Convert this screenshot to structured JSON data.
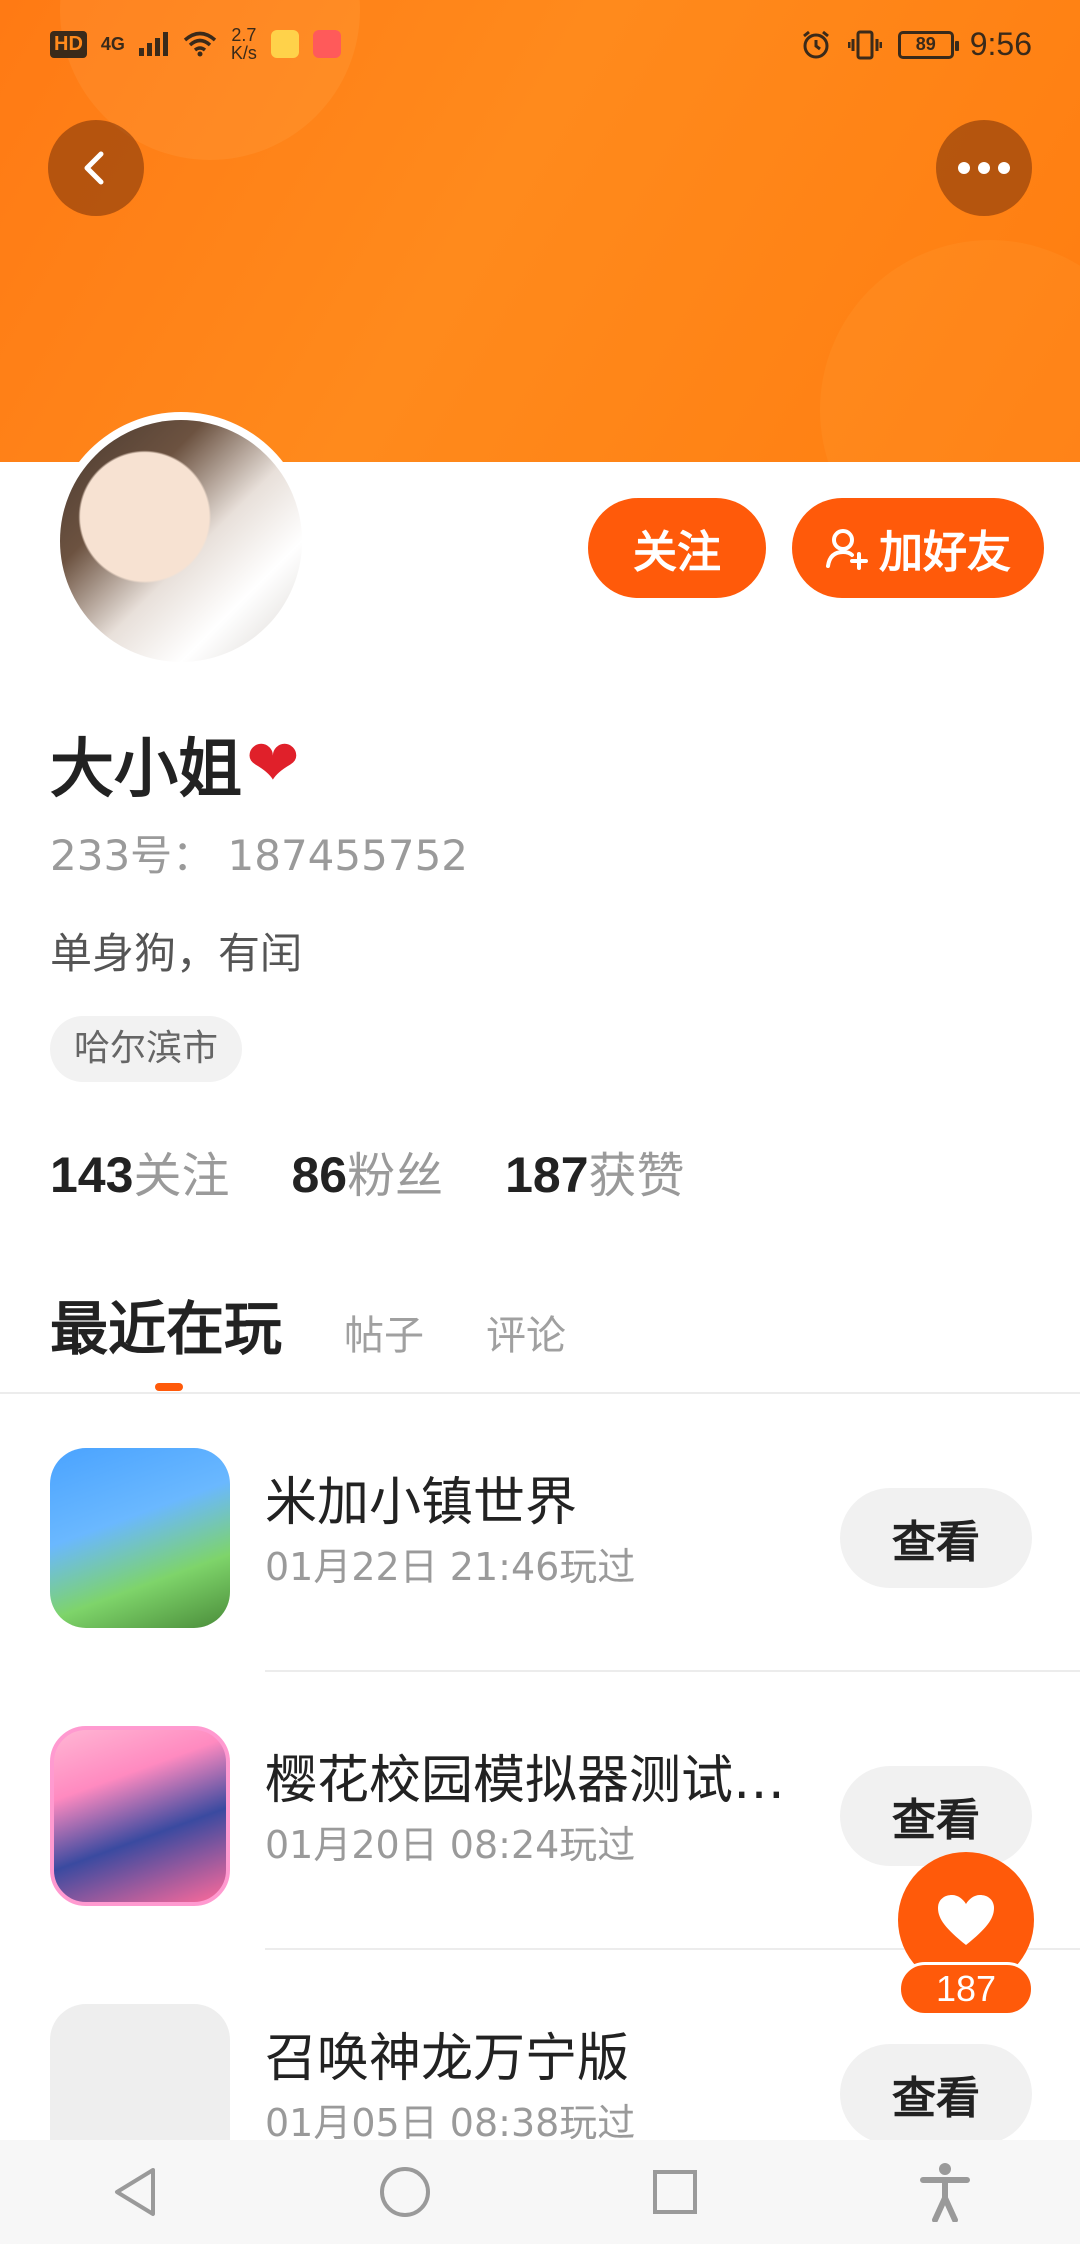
{
  "status_bar": {
    "hd": "HD",
    "network": "4G",
    "speed_value": "2.7",
    "speed_unit": "K/s",
    "battery": "89",
    "time": "9:56"
  },
  "header": {
    "background_color": "#ff8a1c",
    "back_icon": "chevron-left-icon",
    "more_icon": "more-dots-icon"
  },
  "actions": {
    "follow_label": "关注",
    "add_friend_label": "加好友",
    "accent_color": "#ff5a0a"
  },
  "profile": {
    "name": "大小姐",
    "name_emoji": "❤",
    "id_line": "233号：  187455752",
    "bio": "单身狗，有闰",
    "location": "哈尔滨市"
  },
  "stats": [
    {
      "value": "143",
      "label": "关注"
    },
    {
      "value": "86",
      "label": "粉丝"
    },
    {
      "value": "187",
      "label": "获赞"
    }
  ],
  "tabs": [
    {
      "label": "最近在玩",
      "active": true
    },
    {
      "label": "帖子",
      "active": false
    },
    {
      "label": "评论",
      "active": false
    }
  ],
  "games": [
    {
      "title": "米加小镇世界",
      "played": "01月22日 21:46玩过",
      "button": "查看"
    },
    {
      "title": "樱花校园模拟器测试…",
      "played": "01月20日 08:24玩过",
      "button": "查看"
    },
    {
      "title": "召唤神龙万宁版",
      "played": "01月05日 08:38玩过",
      "button": "查看"
    }
  ],
  "like_fab": {
    "icon": "heart-icon",
    "count": "187"
  },
  "nav": [
    "back-triangle-icon",
    "home-circle-icon",
    "recents-square-icon",
    "accessibility-icon"
  ]
}
